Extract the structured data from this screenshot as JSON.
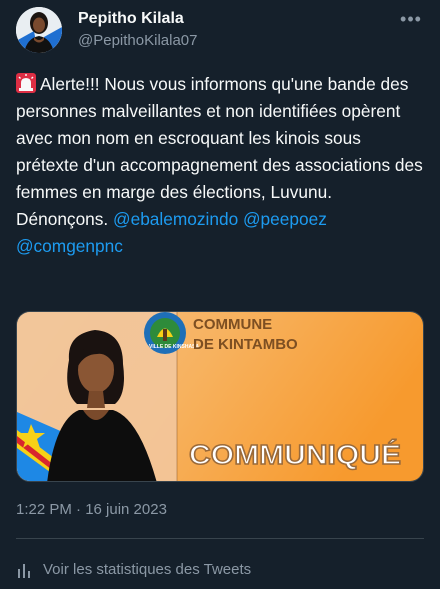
{
  "author": {
    "display_name": "Pepitho Kilala",
    "handle": "@PepithoKilala07"
  },
  "tweet": {
    "siren_icon": "rotating-light-emoji",
    "text_main": "Alerte!!! Nous vous informons qu'une bande des personnes malveillantes et non identifiées opèrent avec mon nom en escroquant les kinois  sous prétexte d'un accompagnement des associations des femmes en marge des élections, Luvunu. Dénonçons.",
    "mentions": [
      "@ebalemozindo",
      "@peepoez",
      "@comgenpnc"
    ]
  },
  "media": {
    "seal_text": "VILLE DE KINSHASA",
    "title_line1": "COMMUNE",
    "title_line2": "DE KINTAMBO",
    "banner": "COMMUNIQUÉ"
  },
  "meta": {
    "timestamp": "1:22 PM · 16 juin 2023",
    "stats_label": "Voir les statistiques des Tweets"
  },
  "colors": {
    "background": "#15202b",
    "accent": "#1d9bf0",
    "secondary_text": "#8b98a5",
    "divider": "#38444d"
  }
}
